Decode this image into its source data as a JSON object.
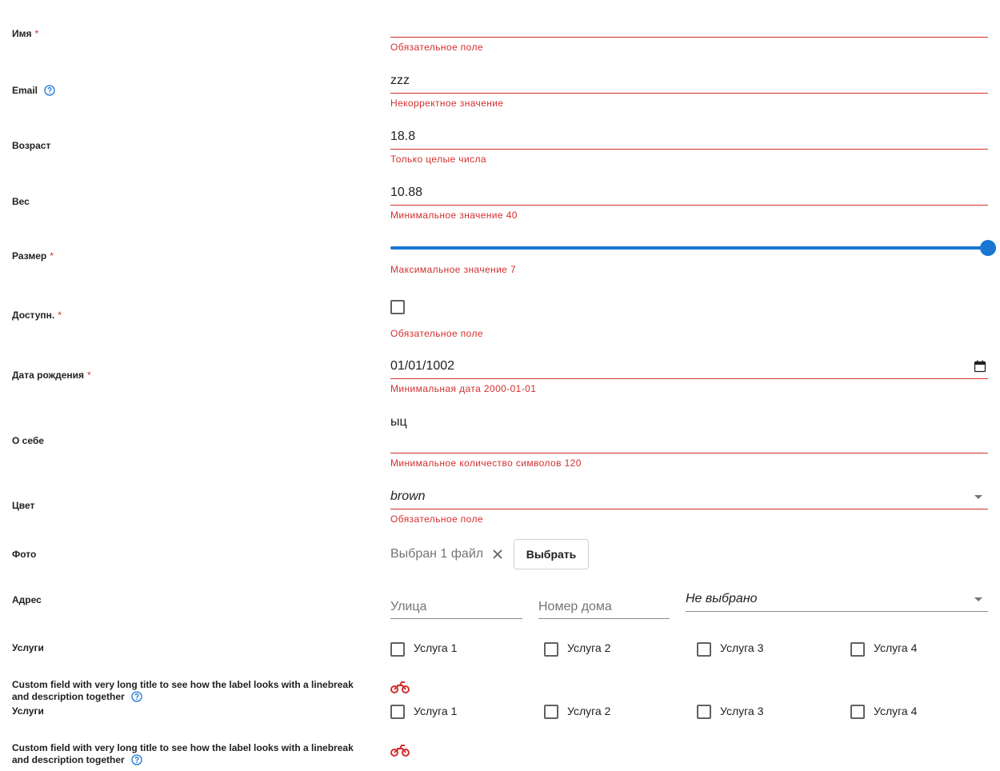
{
  "colors": {
    "accent": "#1976d2",
    "error": "#d32f2f"
  },
  "fields": {
    "name": {
      "label": "Имя",
      "value": "",
      "error": "Обязательное поле"
    },
    "email": {
      "label": "Email",
      "value": "zzz",
      "error": "Некорректное значение"
    },
    "age": {
      "label": "Возраст",
      "value": "18.8",
      "error": "Только целые числа"
    },
    "weight": {
      "label": "Вес",
      "value": "10.88",
      "error": "Минимальное значение 40"
    },
    "size": {
      "label": "Размер",
      "slider_level": 1.0,
      "error": "Максимальное значение 7"
    },
    "available": {
      "label": "Доступн.",
      "checked": false,
      "error": "Обязательное поле"
    },
    "birthdate": {
      "label": "Дата рождения",
      "value": "01/01/1002",
      "error": "Минимальная дата 2000-01-01"
    },
    "about": {
      "label": "О себе",
      "value": "ыц",
      "error": "Минимальное количество символов 120"
    },
    "color": {
      "label": "Цвет",
      "value": "brown",
      "error": "Обязательное поле"
    },
    "photo": {
      "label": "Фото",
      "status": "Выбран 1 файл",
      "button": "Выбрать"
    },
    "address": {
      "label": "Адрес",
      "street_placeholder": "Улица",
      "house_placeholder": "Номер дома",
      "select_value": "Не выбрано"
    },
    "services": {
      "label": "Услуги",
      "options": [
        "Услуга 1",
        "Услуга 2",
        "Услуга 3",
        "Услуга 4"
      ]
    },
    "custom": {
      "label": "Custom field with very long title to see how the label looks with a linebreak and description together",
      "icon": "motorbike-icon"
    }
  },
  "required_mark": "*"
}
